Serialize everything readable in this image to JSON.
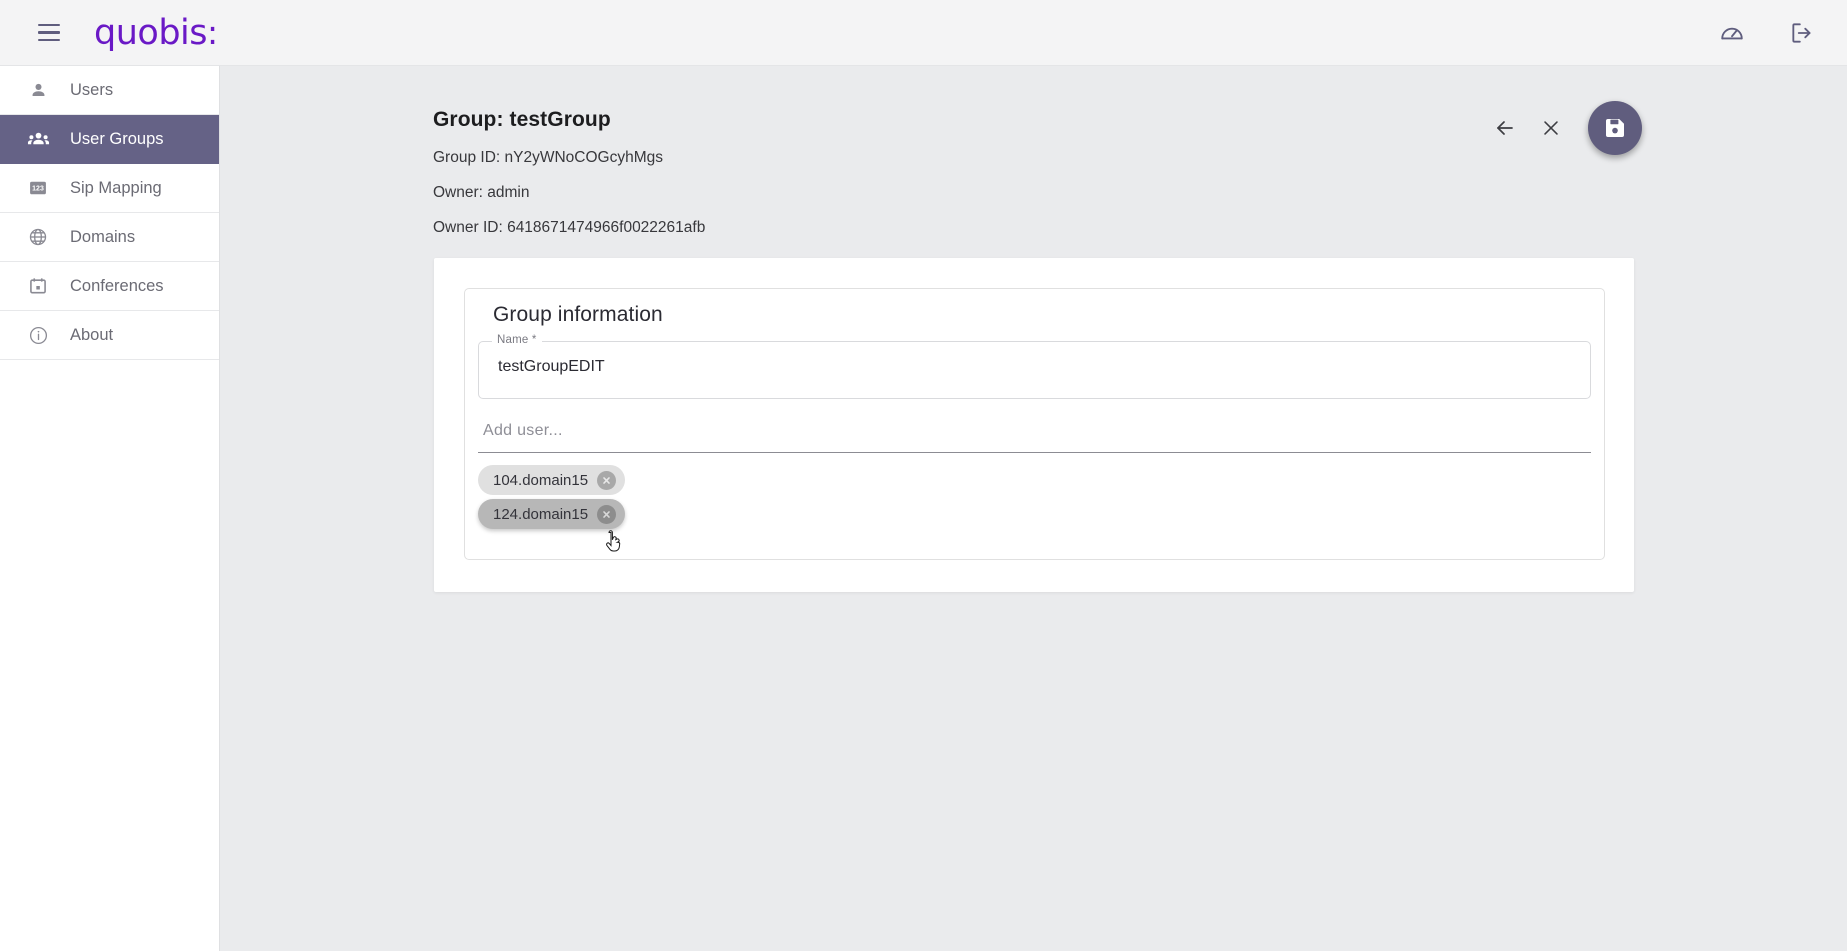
{
  "topbar": {
    "menu_icon": "hamburger-menu-icon",
    "brand": "quobis",
    "brand_suffix": ":",
    "actions": [
      {
        "name": "dashboard-icon",
        "label": "Dashboard"
      },
      {
        "name": "logout-icon",
        "label": "Logout"
      }
    ]
  },
  "sidebar": {
    "items": [
      {
        "label": "Users",
        "icon": "person-icon",
        "active": false
      },
      {
        "label": "User Groups",
        "icon": "group-icon",
        "active": true
      },
      {
        "label": "Sip Mapping",
        "icon": "numbers-icon",
        "active": false
      },
      {
        "label": "Domains",
        "icon": "globe-icon",
        "active": false
      },
      {
        "label": "Conferences",
        "icon": "calendar-icon",
        "active": false
      },
      {
        "label": "About",
        "icon": "info-icon",
        "active": false
      }
    ]
  },
  "page": {
    "title": "Group: testGroup",
    "meta": [
      "Group ID: nY2yWNoCOGcyhMgs",
      "Owner: admin",
      "Owner ID: 6418671474966f0022261afb"
    ],
    "actions": {
      "back_label": "Back",
      "close_label": "Close",
      "save_label": "Save"
    }
  },
  "card": {
    "section_title": "Group information",
    "name_field": {
      "label": "Name *",
      "value": "testGroupEDIT"
    },
    "add_user_field": {
      "placeholder": "Add user...",
      "value": ""
    },
    "chips": [
      {
        "label": "104.domain15",
        "remove_label": "×",
        "hovered": false
      },
      {
        "label": "124.domain15",
        "remove_label": "×",
        "hovered": true
      }
    ]
  },
  "colors": {
    "brand_purple": "#6a19c6",
    "accent_purple": "#605d7e",
    "active_nav": "#656286",
    "page_bg": "#eaebed",
    "topbar_bg": "#f4f4f5"
  }
}
